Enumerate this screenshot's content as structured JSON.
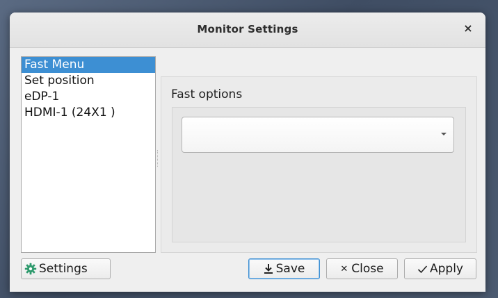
{
  "window": {
    "title": "Monitor Settings",
    "close_symbol": "×"
  },
  "sidebar": {
    "items": [
      {
        "label": "Fast Menu",
        "selected": true
      },
      {
        "label": "Set position",
        "selected": false
      },
      {
        "label": "eDP-1",
        "selected": false
      },
      {
        "label": "HDMI-1 (24X1 )",
        "selected": false
      }
    ]
  },
  "main": {
    "group_label": "Fast options",
    "combo": {
      "value": "",
      "icon": "chevron-down-icon"
    }
  },
  "footer": {
    "settings_label": "Settings",
    "settings_icon": "gear-icon",
    "save_label": "Save",
    "save_icon": "download-icon",
    "close_label": "Close",
    "close_icon": "close-icon",
    "apply_label": "Apply",
    "apply_icon": "check-icon"
  },
  "colors": {
    "selection": "#3d8fd3",
    "gear_green": "#2e9a6d",
    "background": "#efefef"
  }
}
